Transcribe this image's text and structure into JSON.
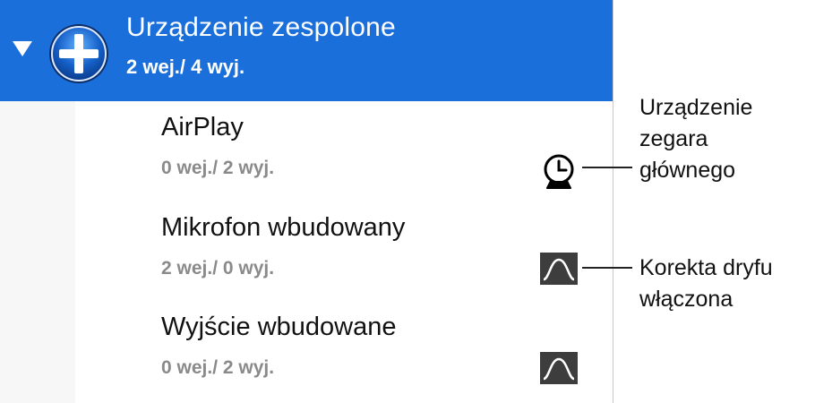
{
  "aggregate_device": {
    "name": "Urządzenie zespolone",
    "io": "2 wej./ 4 wyj."
  },
  "devices": [
    {
      "name": "AirPlay",
      "io": "0 wej./ 2 wyj.",
      "indicator": "clock-icon"
    },
    {
      "name": "Mikrofon wbudowany",
      "io": "2 wej./ 0 wyj.",
      "indicator": "drift-correction-icon"
    },
    {
      "name": "Wyjście wbudowane",
      "io": "0 wej./ 2 wyj.",
      "indicator": "drift-correction-icon"
    }
  ],
  "callouts": {
    "clock_lines": [
      "Urządzenie",
      "zegara",
      "głównego"
    ],
    "drift_lines": [
      "Korekta dryfu",
      "włączona"
    ]
  },
  "colors": {
    "selection": "#1a6fdb",
    "secondary_text": "#8a8a8a"
  }
}
